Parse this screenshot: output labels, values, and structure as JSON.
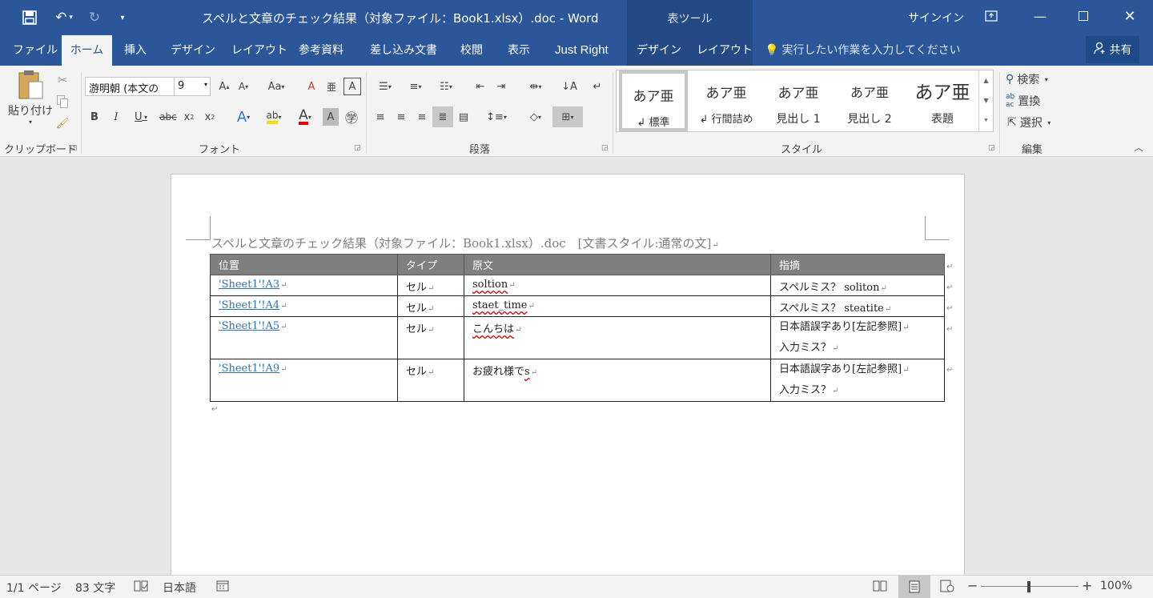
{
  "titlebar": {
    "doc_title": "スペルと文章のチェック結果（対象ファイル：Book1.xlsx）.doc  -  Word",
    "context_group": "表ツール",
    "signin": "サインイン"
  },
  "tabs": {
    "file": "ファイル",
    "home": "ホーム",
    "insert": "挿入",
    "design": "デザイン",
    "layout": "レイアウト",
    "references": "参考資料",
    "mailings": "差し込み文書",
    "review": "校閲",
    "view": "表示",
    "justright": "Just Right",
    "table_design": "デザイン",
    "table_layout": "レイアウト",
    "tell_me": "実行したい作業を入力してください",
    "share": "共有"
  },
  "ribbon": {
    "clipboard": {
      "paste": "貼り付け",
      "label": "クリップボード"
    },
    "font": {
      "name": "游明朝 (本文の",
      "size": "9",
      "label": "フォント"
    },
    "paragraph": {
      "label": "段落"
    },
    "styles": {
      "label": "スタイル",
      "items": [
        {
          "preview": "あア亜",
          "name": "↲ 標準"
        },
        {
          "preview": "あア亜",
          "name": "↲ 行間詰め"
        },
        {
          "preview": "あア亜",
          "name": "見出し 1"
        },
        {
          "preview": "あア亜",
          "name": "見出し 2"
        },
        {
          "preview": "あア亜",
          "name": "表題"
        }
      ]
    },
    "editing": {
      "find": "検索",
      "replace": "置換",
      "select": "選択",
      "label": "編集"
    }
  },
  "document": {
    "heading": "スペルと文章のチェック結果（対象ファイル：Book1.xlsx）.doc　[文書スタイル:通常の文]",
    "columns": [
      "位置",
      "タイプ",
      "原文",
      "指摘"
    ],
    "rows": [
      {
        "pos": "'Sheet1'!A3",
        "type": "セル",
        "orig": "soltion",
        "note1": "スペルミス？  soliton",
        "note2": ""
      },
      {
        "pos": "'Sheet1'!A4",
        "type": "セル",
        "orig": "staet_time",
        "note1": "スペルミス？  steatite",
        "note2": ""
      },
      {
        "pos": "'Sheet1'!A5",
        "type": "セル",
        "orig": "こんちは",
        "note1": "日本語誤字あり[左記参照]",
        "note2": "入力ミス？"
      },
      {
        "pos": "'Sheet1'!A9",
        "type": "セル",
        "orig_prefix": "お疲れ様で",
        "orig_err": "s",
        "note1": "日本語誤字あり[左記参照]",
        "note2": "入力ミス？"
      }
    ]
  },
  "status": {
    "page": "1/1 ページ",
    "words": "83 文字",
    "language": "日本語",
    "zoom": "100%",
    "zoom_level": 1.0
  }
}
